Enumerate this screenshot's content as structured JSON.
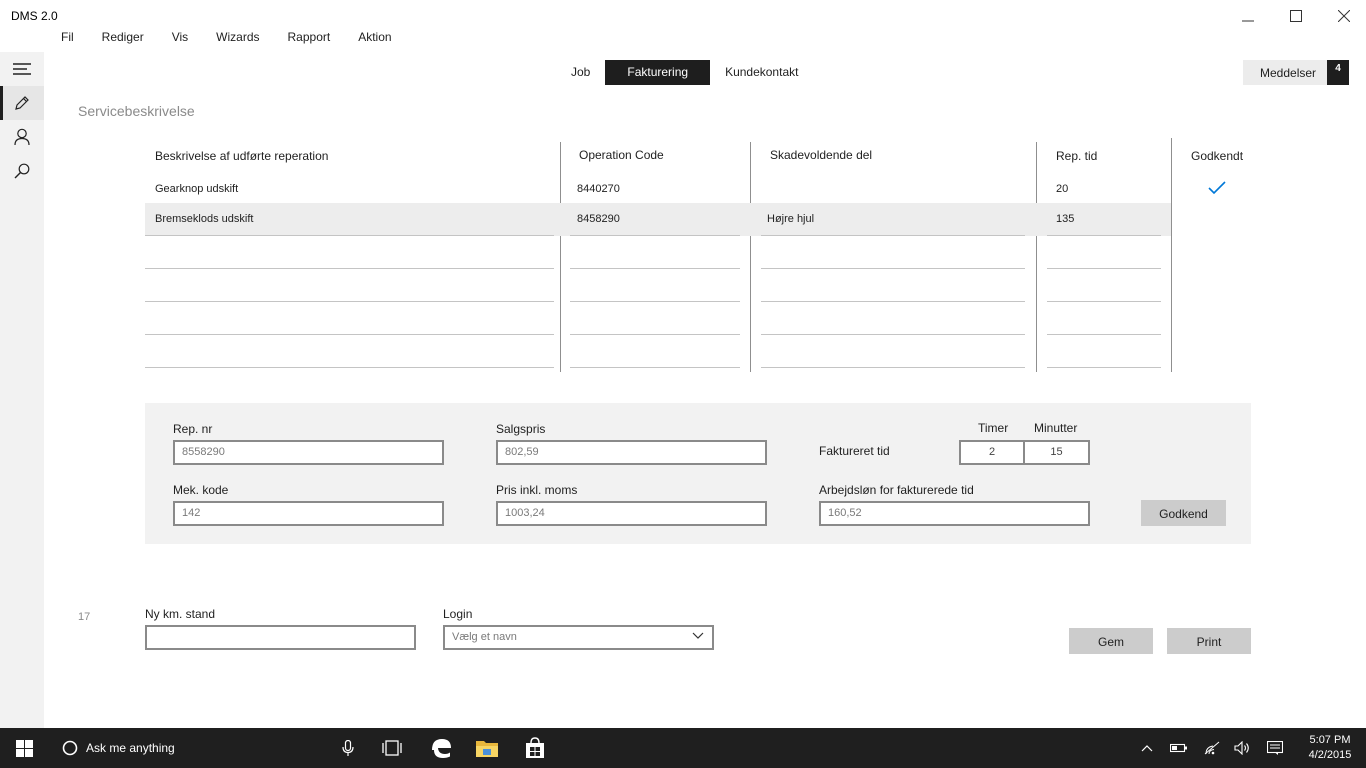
{
  "window": {
    "title": "DMS 2.0"
  },
  "menu": [
    "Fil",
    "Rediger",
    "Vis",
    "Wizards",
    "Rapport",
    "Aktion"
  ],
  "tabs": [
    {
      "label": "Job",
      "active": false
    },
    {
      "label": "Fakturering",
      "active": true
    },
    {
      "label": "Kundekontakt",
      "active": false
    }
  ],
  "messages": {
    "label": "Meddelser",
    "count": "4"
  },
  "section_title": "Servicebeskrivelse",
  "table": {
    "headers": {
      "description": "Beskrivelse af udførte reperation",
      "operation_code": "Operation Code",
      "damaging_part": "Skadevoldende del",
      "rep_time": "Rep. tid",
      "approved": "Godkendt"
    },
    "rows": [
      {
        "description": "Gearknop udskift",
        "operation_code": "8440270",
        "damaging_part": "",
        "rep_time": "20",
        "approved": true,
        "selected": false
      },
      {
        "description": "Bremseklods udskift",
        "operation_code": "8458290",
        "damaging_part": "Højre hjul",
        "rep_time": "135",
        "approved": false,
        "selected": true
      }
    ]
  },
  "form": {
    "rep_nr": {
      "label": "Rep. nr",
      "value": "8558290"
    },
    "salgspris": {
      "label": "Salgspris",
      "value": "802,59"
    },
    "faktureret_tid": {
      "label": "Faktureret tid",
      "timer_label": "Timer",
      "minutter_label": "Minutter",
      "timer": "2",
      "minutter": "15"
    },
    "mek_kode": {
      "label": "Mek. kode",
      "value": "142"
    },
    "pris_inkl_moms": {
      "label": "Pris inkl. moms",
      "value": "1003,24"
    },
    "arbejdslon": {
      "label": "Arbejdsløn for fakturerede tid",
      "value": "160,52"
    },
    "approve_button": "Godkend"
  },
  "footer": {
    "number": "17",
    "km_label": "Ny km. stand",
    "km_value": "",
    "login_label": "Login",
    "login_placeholder": "Vælg et navn",
    "save_button": "Gem",
    "print_button": "Print"
  },
  "taskbar": {
    "search_placeholder": "Ask me anything",
    "time": "5:07 PM",
    "date": "4/2/2015"
  },
  "colors": {
    "accent": "#0078d7",
    "dark": "#1e1e1e",
    "panel": "#f2f2f2"
  }
}
